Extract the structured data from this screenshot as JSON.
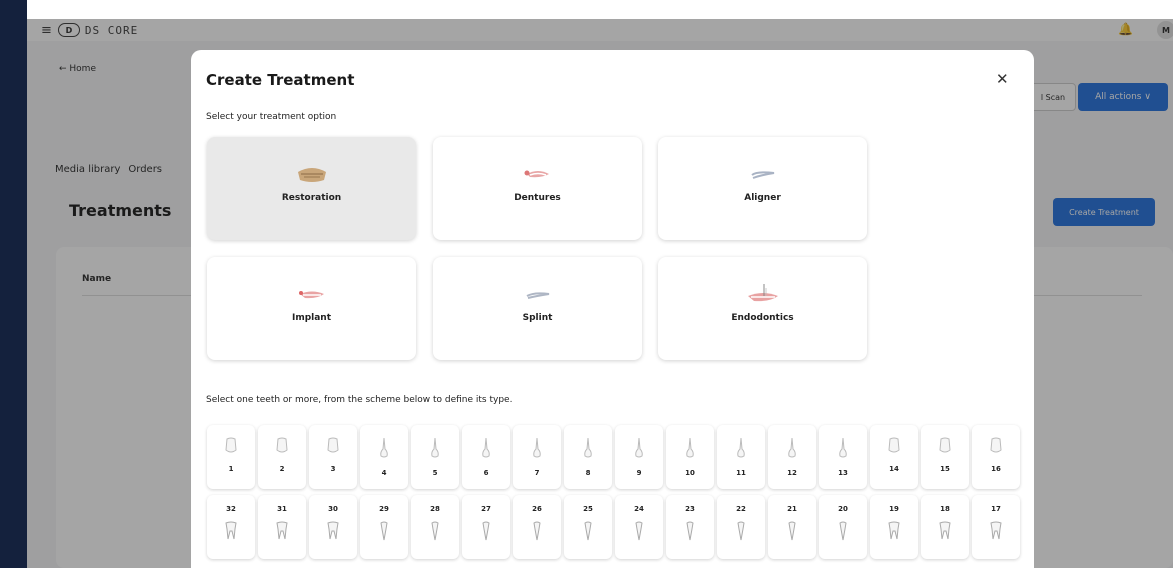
{
  "app": {
    "logo_text": "DS CORE",
    "logo_mark": "D",
    "avatar_initials": "M",
    "home_link": "← Home",
    "tabs": [
      "Media library",
      "Orders"
    ],
    "page_title": "Treatments",
    "scan_button": "l Scan",
    "all_actions_button": "All actions ∨",
    "create_treatment_button": "Create Treatment",
    "table_column_name": "Name"
  },
  "modal": {
    "title": "Create Treatment",
    "close_icon": "close-icon",
    "subtitle": "Select your treatment option",
    "options": [
      {
        "label": "Restoration",
        "icon": "restoration-icon",
        "selected": true
      },
      {
        "label": "Dentures",
        "icon": "dentures-icon",
        "selected": false
      },
      {
        "label": "Aligner",
        "icon": "aligner-icon",
        "selected": false
      },
      {
        "label": "Implant",
        "icon": "implant-icon",
        "selected": false
      },
      {
        "label": "Splint",
        "icon": "splint-icon",
        "selected": false
      },
      {
        "label": "Endodontics",
        "icon": "endodontics-icon",
        "selected": false
      }
    ],
    "teeth_hint": "Select one teeth or more, from the scheme below to define its type.",
    "upper_teeth": [
      "1",
      "2",
      "3",
      "4",
      "5",
      "6",
      "7",
      "8",
      "9",
      "10",
      "11",
      "12",
      "13",
      "14",
      "15",
      "16"
    ],
    "lower_teeth": [
      "32",
      "31",
      "30",
      "29",
      "28",
      "27",
      "26",
      "25",
      "24",
      "23",
      "22",
      "21",
      "20",
      "19",
      "18",
      "17"
    ]
  },
  "colors": {
    "accent_blue": "#1a6bdc",
    "left_rail": "#14213d",
    "selected_card": "#e9e9e9"
  }
}
